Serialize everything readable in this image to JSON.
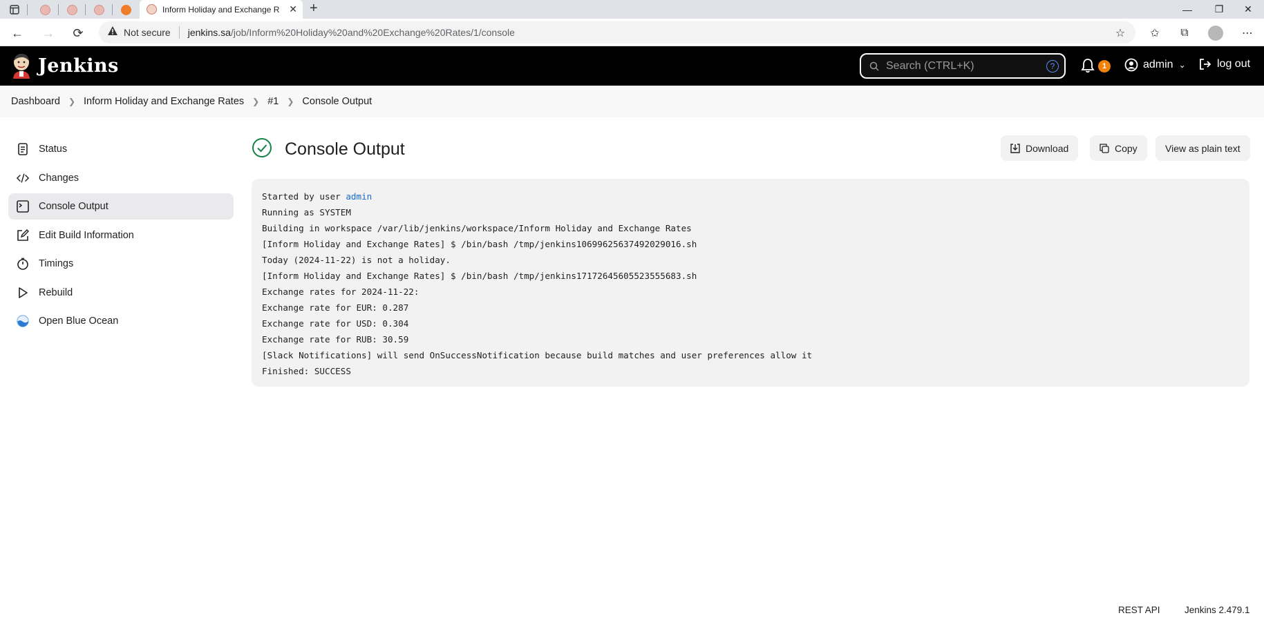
{
  "browser": {
    "active_tab_title": "Inform Holiday and Exchange Ra",
    "not_secure": "Not secure",
    "url_host": "jenkins.sa",
    "url_path": "/job/Inform%20Holiday%20and%20Exchange%20Rates/1/console"
  },
  "header": {
    "logo_text": "Jenkins",
    "search_placeholder": "Search (CTRL+K)",
    "notification_count": "1",
    "user": "admin",
    "logout": "log out"
  },
  "breadcrumb": [
    "Dashboard",
    "Inform Holiday and Exchange Rates",
    "#1",
    "Console Output"
  ],
  "sidebar": {
    "items": [
      {
        "label": "Status",
        "icon": "document-icon"
      },
      {
        "label": "Changes",
        "icon": "code-icon"
      },
      {
        "label": "Console Output",
        "icon": "terminal-icon",
        "active": true
      },
      {
        "label": "Edit Build Information",
        "icon": "edit-icon"
      },
      {
        "label": "Timings",
        "icon": "stopwatch-icon"
      },
      {
        "label": "Rebuild",
        "icon": "play-icon"
      },
      {
        "label": "Open Blue Ocean",
        "icon": "blue-ocean-icon"
      }
    ]
  },
  "main": {
    "title": "Console Output",
    "status": "success",
    "buttons": {
      "download": "Download",
      "copy": "Copy",
      "plain": "View as plain text"
    },
    "console_prefix": "Started by user ",
    "console_user": "admin",
    "console_lines": [
      "Running as SYSTEM",
      "Building in workspace /var/lib/jenkins/workspace/Inform Holiday and Exchange Rates",
      "[Inform Holiday and Exchange Rates] $ /bin/bash /tmp/jenkins10699625637492029016.sh",
      "Today (2024-11-22) is not a holiday.",
      "[Inform Holiday and Exchange Rates] $ /bin/bash /tmp/jenkins17172645605523555683.sh",
      "Exchange rates for 2024-11-22:",
      "Exchange rate for EUR: 0.287",
      "Exchange rate for USD: 0.304",
      "Exchange rate for RUB: 30.59",
      "[Slack Notifications] will send OnSuccessNotification because build matches and user preferences allow it",
      "Finished: SUCCESS"
    ]
  },
  "footer": {
    "rest_api": "REST API",
    "version": "Jenkins 2.479.1"
  },
  "colors": {
    "accent": "#1769d1",
    "success": "#138347",
    "badge": "#f0820a",
    "header_bg": "#000000"
  }
}
